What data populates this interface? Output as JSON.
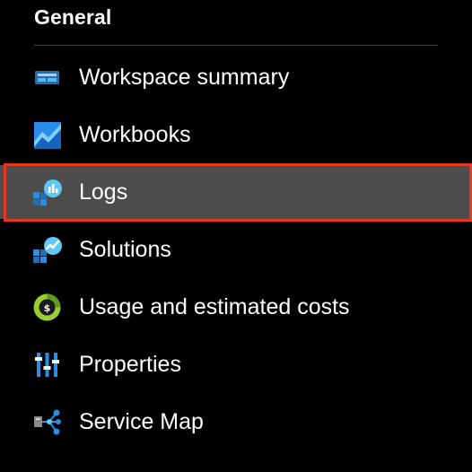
{
  "section": {
    "title": "General"
  },
  "menu": {
    "items": [
      {
        "label": "Workspace summary",
        "icon": "workspace-summary-icon"
      },
      {
        "label": "Workbooks",
        "icon": "workbooks-icon"
      },
      {
        "label": "Logs",
        "icon": "logs-icon",
        "selected": true
      },
      {
        "label": "Solutions",
        "icon": "solutions-icon"
      },
      {
        "label": "Usage and estimated costs",
        "icon": "usage-costs-icon"
      },
      {
        "label": "Properties",
        "icon": "properties-icon"
      },
      {
        "label": "Service Map",
        "icon": "service-map-icon"
      }
    ]
  },
  "colors": {
    "background": "#000000",
    "selected_background": "#4d4d4d",
    "highlight_border": "#e8361f",
    "accent_blue": "#1e90e0"
  }
}
